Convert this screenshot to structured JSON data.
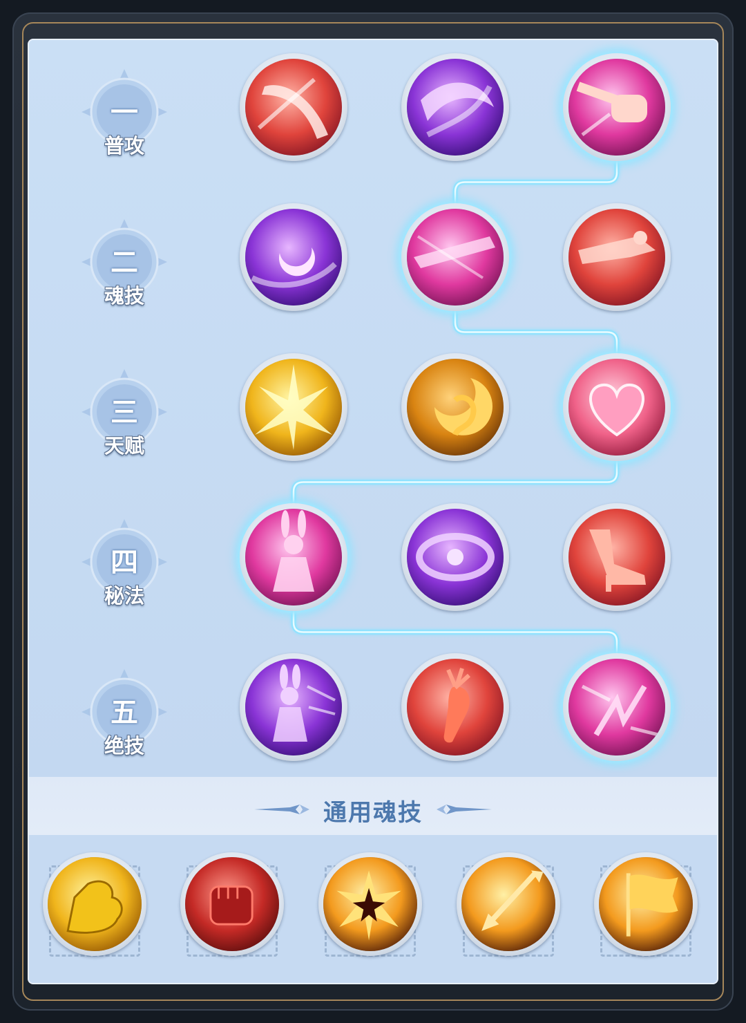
{
  "tiers": [
    {
      "num": "一",
      "label": "普攻"
    },
    {
      "num": "二",
      "label": "魂技"
    },
    {
      "num": "三",
      "label": "天赋"
    },
    {
      "num": "四",
      "label": "秘法"
    },
    {
      "num": "五",
      "label": "绝技"
    }
  ],
  "skill_rows": [
    [
      {
        "icon": "blade-slash-icon",
        "theme": "red",
        "selected": false
      },
      {
        "icon": "purple-wave-icon",
        "theme": "purple",
        "selected": false
      },
      {
        "icon": "fist-strike-icon",
        "theme": "pink",
        "selected": true
      }
    ],
    [
      {
        "icon": "crescent-moon-icon",
        "theme": "purple",
        "selected": false
      },
      {
        "icon": "dash-kick-icon",
        "theme": "pink",
        "selected": true
      },
      {
        "icon": "flying-kick-icon",
        "theme": "red",
        "selected": false
      }
    ],
    [
      {
        "icon": "golden-burst-icon",
        "theme": "gold",
        "selected": false
      },
      {
        "icon": "golden-crescent-icon",
        "theme": "amber",
        "selected": false
      },
      {
        "icon": "heart-icon",
        "theme": "rose",
        "selected": true
      }
    ],
    [
      {
        "icon": "rabbit-girl-icon",
        "theme": "pink",
        "selected": true
      },
      {
        "icon": "purple-vortex-icon",
        "theme": "purple",
        "selected": false
      },
      {
        "icon": "high-heel-icon",
        "theme": "red",
        "selected": false
      }
    ],
    [
      {
        "icon": "rabbit-dash-icon",
        "theme": "purple",
        "selected": false
      },
      {
        "icon": "carrot-icon",
        "theme": "red",
        "selected": false
      },
      {
        "icon": "pink-spark-icon",
        "theme": "pink",
        "selected": true
      }
    ]
  ],
  "common_section": {
    "title": "通用魂技",
    "skills": [
      {
        "icon": "flexed-arm-icon",
        "theme": "gold"
      },
      {
        "icon": "clenched-fist-icon",
        "theme": "crimson"
      },
      {
        "icon": "star-burst-icon",
        "theme": "fire"
      },
      {
        "icon": "arrow-strike-icon",
        "theme": "fire"
      },
      {
        "icon": "banner-flag-icon",
        "theme": "fire"
      }
    ]
  },
  "colors": {
    "panel": "#c8dcf3",
    "path_glow": "#8fe3ff",
    "title_text": "#4d78ad",
    "frame_gold": "#a6875a"
  }
}
